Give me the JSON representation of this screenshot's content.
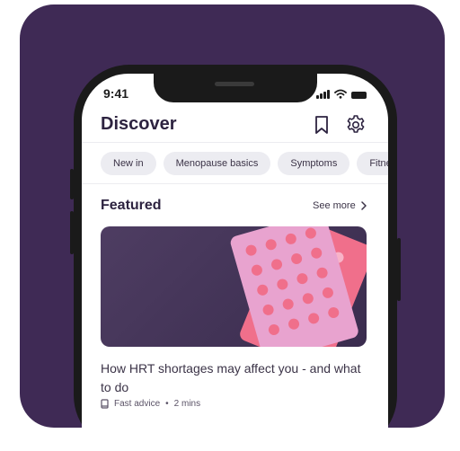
{
  "status_bar": {
    "time": "9:41"
  },
  "header": {
    "title": "Discover",
    "bookmark_icon": "bookmark-icon",
    "settings_icon": "gear-icon"
  },
  "categories": [
    "New in",
    "Menopause basics",
    "Symptoms",
    "Fitnes"
  ],
  "featured": {
    "heading": "Featured",
    "see_more": "See more",
    "article": {
      "title": "How HRT shortages may affect you - and what to do",
      "category": "Fast advice",
      "separator": "•",
      "duration": "2 mins"
    }
  },
  "colors": {
    "background": "#3f2a55",
    "text": "#2d2340",
    "chip": "#ececf1",
    "pill_pink": "#f06f8b",
    "pill_lilac": "#e8a3cf"
  }
}
